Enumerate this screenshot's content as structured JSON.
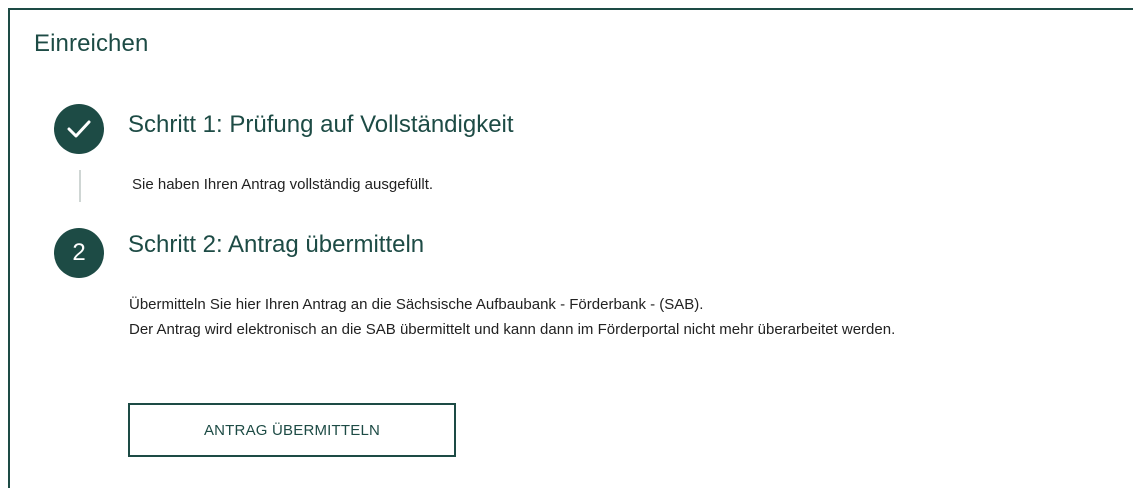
{
  "panel": {
    "title": "Einreichen"
  },
  "steps": [
    {
      "status": "completed",
      "icon": "check-icon",
      "title": "Schritt 1: Prüfung auf Vollständigkeit",
      "text": "Sie haben Ihren Antrag vollständig ausgefüllt."
    },
    {
      "status": "current",
      "number": "2",
      "title": "Schritt 2: Antrag übermitteln",
      "text_line1": "Übermitteln Sie hier Ihren Antrag an die Sächsische Aufbaubank - Förderbank - (SAB).",
      "text_line2": "Der Antrag wird elektronisch an die SAB übermittelt und kann dann im Förderportal nicht mehr überarbeitet werden.",
      "button_label": "ANTRAG ÜBERMITTELN"
    }
  ],
  "colors": {
    "accent": "#1d4b45",
    "connector": "#cfd6d4",
    "text": "#222222"
  }
}
